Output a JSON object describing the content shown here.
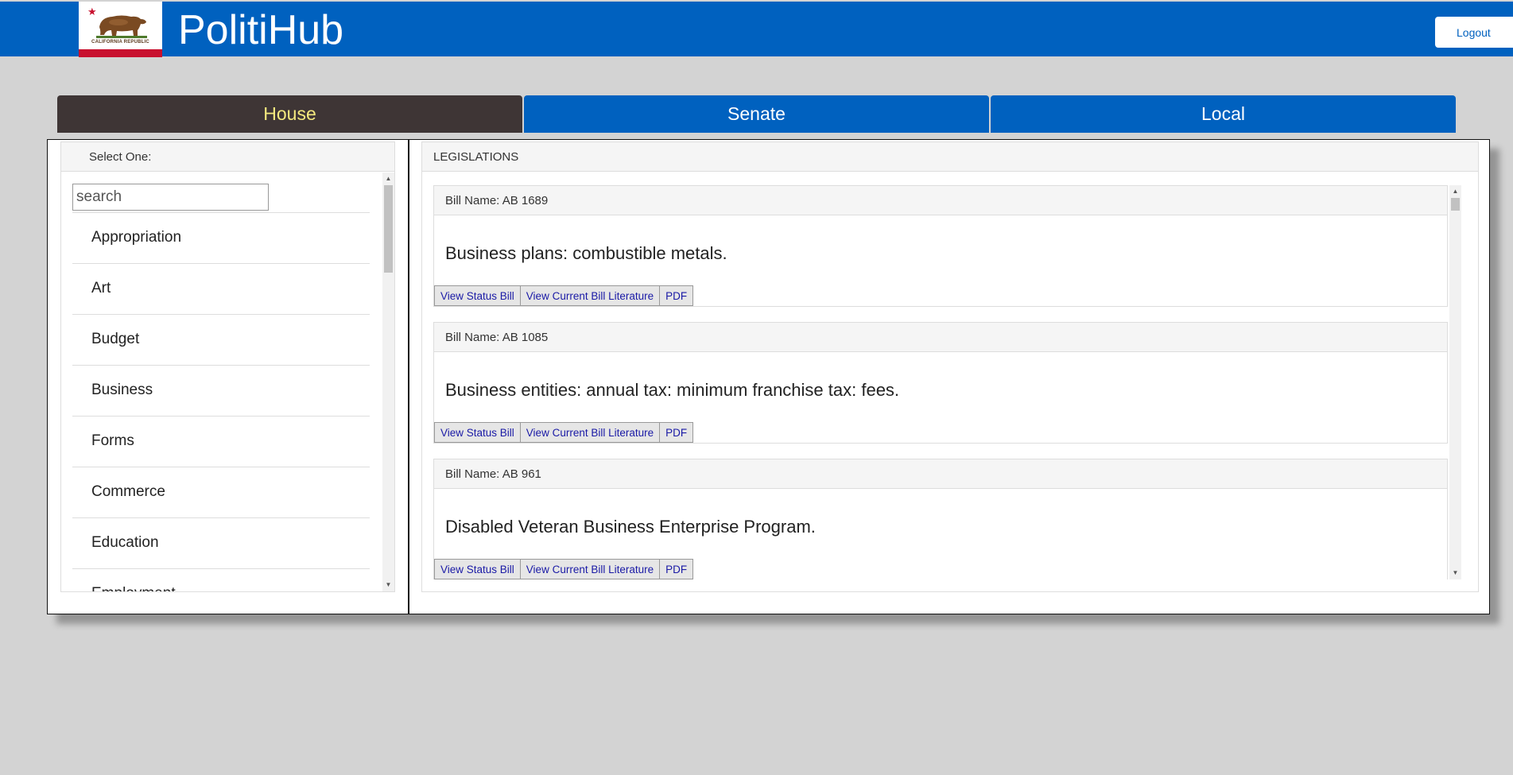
{
  "header": {
    "logo_text": "CALIFORNIA REPUBLIC",
    "title": "PolitiHub",
    "logout_label": "Logout"
  },
  "tabs": [
    {
      "label": "House",
      "active": true
    },
    {
      "label": "Senate",
      "active": false
    },
    {
      "label": "Local",
      "active": false
    }
  ],
  "left_panel": {
    "title": "Select One:",
    "search_placeholder": "search",
    "categories": [
      "Appropriation",
      "Art",
      "Budget",
      "Business",
      "Forms",
      "Commerce",
      "Education",
      "Employment"
    ]
  },
  "right_panel": {
    "title": "LEGISLATIONS",
    "bills": [
      {
        "name": "Bill Name: AB 1689",
        "description": "Business plans: combustible metals."
      },
      {
        "name": "Bill Name: AB 1085",
        "description": "Business entities: annual tax: minimum franchise tax: fees."
      },
      {
        "name": "Bill Name: AB 961",
        "description": "Disabled Veteran Business Enterprise Program."
      }
    ],
    "actions": {
      "status": "View Status Bill",
      "literature": "View Current Bill Literature",
      "pdf": "PDF"
    }
  },
  "colors": {
    "primary_blue": "#0061bf",
    "active_tab_bg": "#3e3535",
    "active_tab_text": "#f4e97e",
    "page_bg": "#d3d3d3",
    "flag_red": "#c8102e"
  }
}
